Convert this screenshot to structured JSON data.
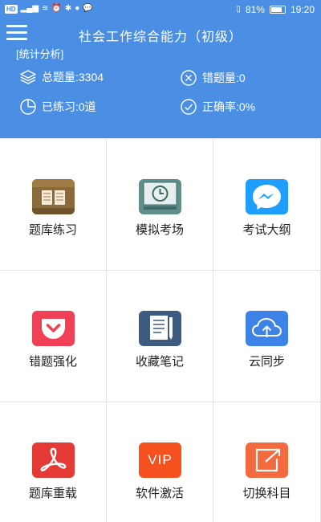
{
  "status_bar": {
    "left_badge": "HD",
    "battery_percent": "81%",
    "battery_level": 0.81,
    "time": "19:20"
  },
  "header": {
    "title": "社会工作综合能力（初级）",
    "section_label": "[统计分析]",
    "stats": {
      "total": "总题量:3304",
      "wrong": "错题量:0",
      "practiced": "已练习:0道",
      "accuracy": "正确率:0%"
    }
  },
  "grid": {
    "items": [
      {
        "label": "题库练习",
        "icon": "book-icon",
        "color": "#8a6a3a"
      },
      {
        "label": "模拟考场",
        "icon": "clock-board-icon",
        "color": "#5f8f8c"
      },
      {
        "label": "考试大纲",
        "icon": "messenger-icon",
        "color": "#1e9fff"
      },
      {
        "label": "错题强化",
        "icon": "pocket-icon",
        "color": "#ef4056"
      },
      {
        "label": "收藏笔记",
        "icon": "notes-icon",
        "color": "#3d5a80"
      },
      {
        "label": "云同步",
        "icon": "cloud-upload-icon",
        "color": "#3d82e6"
      },
      {
        "label": "题库重载",
        "icon": "acrobat-icon",
        "color": "#e53935"
      },
      {
        "label": "软件激活",
        "icon": "vip-icon",
        "color": "#f4511e",
        "vip_text": "VIP"
      },
      {
        "label": "切换科目",
        "icon": "switch-icon",
        "color": "#f26a3d"
      }
    ]
  },
  "colors": {
    "header_bg": "#4a8fe3",
    "grid_border": "#e2e2e2"
  }
}
